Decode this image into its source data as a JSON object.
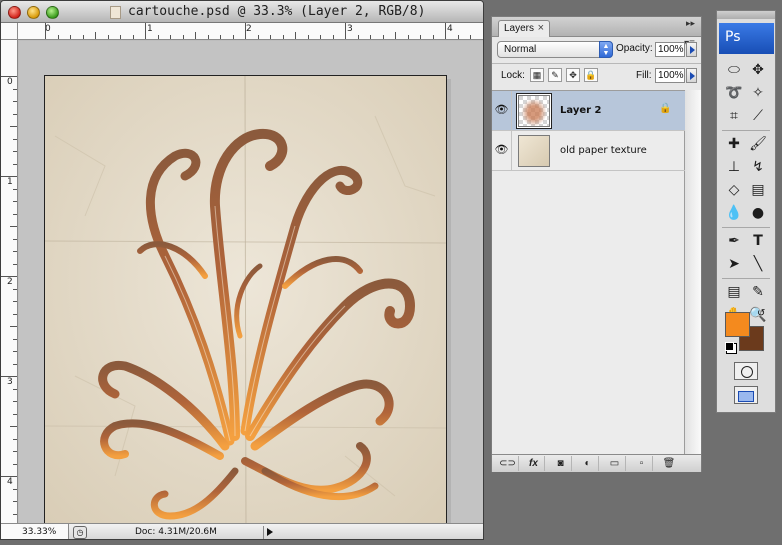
{
  "document": {
    "title": "cartouche.psd @ 33.3% (Layer 2, RGB/8)",
    "zoom": "33.33%",
    "doc_info": "Doc: 4.31M/20.6M",
    "ruler_top_labels": [
      "0",
      "1",
      "2",
      "3",
      "4"
    ],
    "ruler_left_labels": [
      "0",
      "1",
      "2",
      "3",
      "4"
    ]
  },
  "layers_panel": {
    "tab_label": "Layers",
    "tab_close": "×",
    "collapse_glyph": "▸▸",
    "menu_glyph": "▾≡",
    "blend_mode": "Normal",
    "opacity_label": "Opacity:",
    "opacity_value": "100%",
    "lock_label": "Lock:",
    "fill_label": "Fill:",
    "fill_value": "100%",
    "layers": [
      {
        "name": "Layer 2",
        "visible": true,
        "selected": true,
        "locked": true
      },
      {
        "name": "old paper texture",
        "visible": true,
        "selected": false,
        "locked": false
      }
    ],
    "footer_icons": [
      "link-icon",
      "fx-icon",
      "mask-icon",
      "adjustment-icon",
      "group-icon",
      "new-layer-icon",
      "trash-icon"
    ],
    "footer_glyphs": {
      "link": "⊂⊃",
      "fx": "fx",
      "mask": "◙",
      "adjust": "◐",
      "group": "▭",
      "new": "▫",
      "trash": "🗑"
    }
  },
  "tools_panel": {
    "logo": "Ps",
    "foreground_color": "#f48a1e",
    "background_color": "#6b3a1c",
    "icons": [
      "marquee-icon",
      "move-icon",
      "lasso-icon",
      "magic-wand-icon",
      "crop-icon",
      "slice-icon",
      "healing-brush-icon",
      "brush-icon",
      "clone-stamp-icon",
      "history-brush-icon",
      "eraser-icon",
      "gradient-icon",
      "blur-icon",
      "dodge-icon",
      "pen-icon",
      "type-icon",
      "path-selection-icon",
      "line-icon",
      "notes-icon",
      "eyedropper-icon",
      "hand-icon",
      "zoom-icon"
    ]
  },
  "colors": {
    "selected_layer": "#b7c6da",
    "paper": "#e8dfd0",
    "acanthus_top": "#8b5a3c",
    "acanthus_bottom": "#f4a040"
  }
}
